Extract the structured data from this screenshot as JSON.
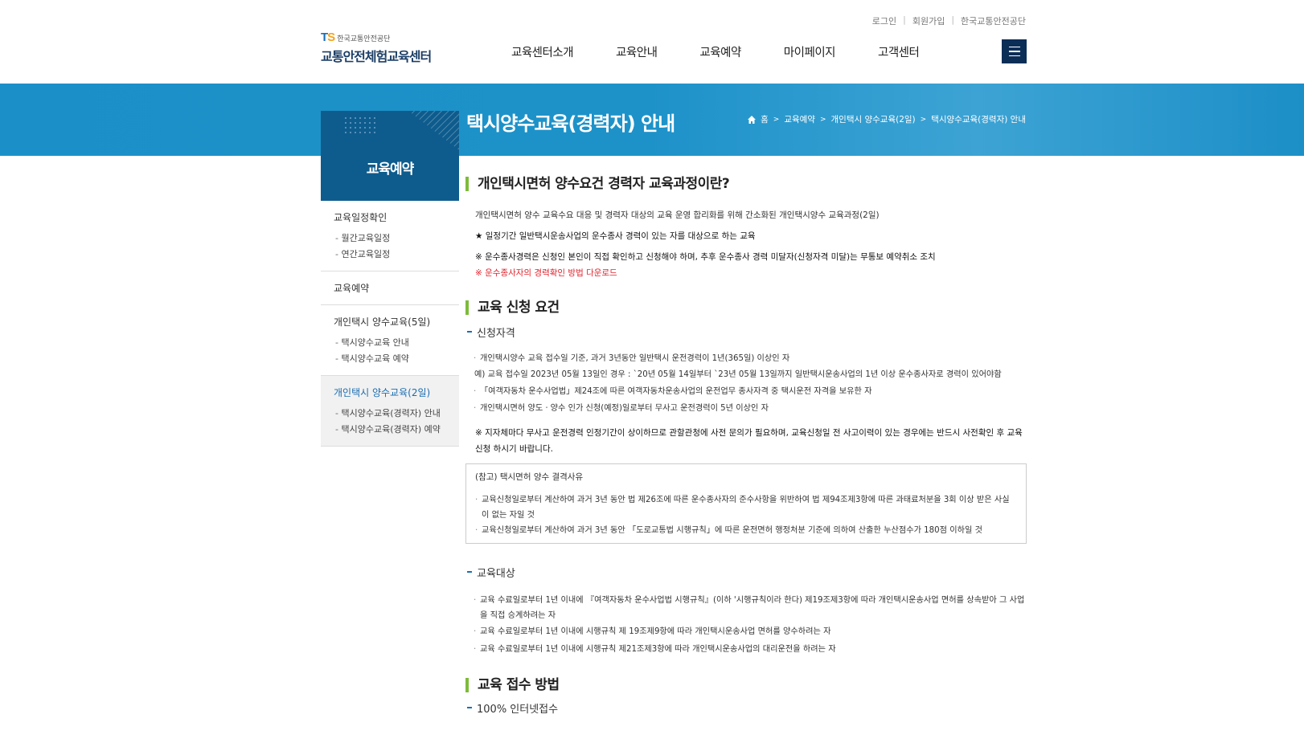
{
  "header": {
    "util_links": [
      "로그인",
      "회원가입",
      "한국교통안전공단"
    ],
    "logo_ts": "TS",
    "logo_org": "한국교통안전공단",
    "logo_name": "교통안전체험교육센터",
    "nav": [
      "교육센터소개",
      "교육안내",
      "교육예약",
      "마이페이지",
      "고객센터"
    ]
  },
  "banner": {
    "title": "택시양수교육(경력자) 안내",
    "breadcrumb": [
      "홈",
      "교육예약",
      "개인택시 양수교육(2일)",
      "택시양수교육(경력자) 안내"
    ]
  },
  "sidebar": {
    "title": "교육예약",
    "groups": [
      {
        "label": "교육일정확인",
        "items": [
          "월간교육일정",
          "연간교육일정"
        ]
      },
      {
        "label": "교육예약",
        "items": []
      },
      {
        "label": "개인택시 양수교육(5일)",
        "items": [
          "택시양수교육 안내",
          "택시양수교육 예약"
        ]
      },
      {
        "label": "개인택시 양수교육(2일)",
        "items": [
          "택시양수교육(경력자) 안내",
          "택시양수교육(경력자) 예약"
        ]
      }
    ]
  },
  "content": {
    "s1_title": "개인택시면허 양수요건 경력자 교육과정이란?",
    "s1_p1": "개인택시면허 양수 교육수요 대응 및 경력자 대상의 교육 운영 합리화를 위해 간소화된 개인택시양수 교육과정(2일)",
    "s1_p2": "★ 일정기간 일반택시운송사업의 운수종사 경력이 있는 자를 대상으로 하는 교육",
    "s1_p3": "※ 운수종사경력은 신청인 본인이 직접 확인하고 신청해야 하며, 추후 운수종사 경력 미달자(신청자격 미달)는 무통보 예약취소 조치",
    "s1_link": "※ 운수종사자의 경력확인 방법 다운로드",
    "s2_title": "교육 신청 요건",
    "s2_sub1": "신청자격",
    "s2_li1": "개인택시양수 교육 접수일 기준, 과거 3년동안 일반택시 운전경력이 1년(365일) 이상인 자",
    "s2_ex": "예) 교육 접수일 2023년 05월 13일인 경우 : `20년 05월 14일부터 `23년 05월 13일까지 일반택시운송사업의 1년 이상 운수종사자로 경력이 있어야함",
    "s2_li2": "「여객자동차 운수사업법」제24조에 따른 여객자동차운송사업의 운전업무 종사자격 중 택시운전 자격을 보유한 자",
    "s2_li3": "개인택시면허 양도ㆍ양수 인가 신청(예정)일로부터 무사고 운전경력이 5년 이상인 자",
    "s2_note": "※ 지자체마다 무사고 운전경력 인정기간이 상이하므로 관할관청에 사전 문의가 필요하며, 교육신청일 전 사고이력이 있는 경우에는 반드시 사전확인 후 교육신청 하시기 바랍니다.",
    "box_title": "(참고) 택시면허 양수 결격사유",
    "box_li1": "교육신청일로부터 계산하여 과거 3년 동안 법 제26조에 따른 운수종사자의 준수사항을 위반하여 법 제94조제3항에 따른 과태료처분을 3회 이상 받은 사실이 없는 자일 것",
    "box_li2": "교육신청일로부터 계산하여 과거 3년 동안 「도로교통법 시행규칙」에 따른 운전면허 행정처분 기준에 의하여 산출한 누산점수가 180점 이하일 것",
    "s2_sub2": "교육대상",
    "s2_t1": "교육 수료일로부터 1년 이내에 『여객자동차 운수사업법 시행규칙』(이하 '시행규칙이라 한다) 제19조제3항에 따라 개인택시운송사업 면허를 상속받아 그 사업을 직접 승계하려는 자",
    "s2_t2": "교육 수료일로부터 1년 이내에 시행규칙 제 19조제9항에 따라 개인택시운송사업 면허를 양수하려는 자",
    "s2_t3": "교육 수료일로부터 1년 이내에 시행규칙 제21조제3항에 따라 개인택시운송사업의 대리운전을 하려는 자",
    "s3_title": "교육 접수 방법",
    "s3_sub1": "100% 인터넷접수"
  },
  "colors": {
    "banner": "#1b90c8",
    "side_head": "#0e5c8d",
    "accent_bar": "#7dbb3b",
    "menu_btn": "#0b2e57",
    "link_red": "#e0242e"
  }
}
